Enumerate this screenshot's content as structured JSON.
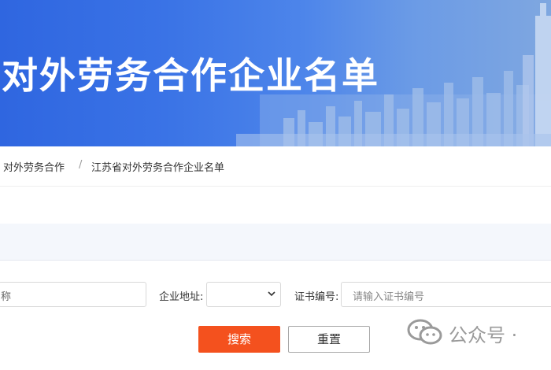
{
  "banner": {
    "title": "对外劳务合作企业名单"
  },
  "breadcrumb": {
    "items": [
      "对外劳务合作",
      "江苏省对外劳务合作企业名单"
    ],
    "separator": "/"
  },
  "search_form": {
    "name_field": {
      "value_fragment": "称"
    },
    "address_label": "企业地址:",
    "address_select": {
      "selected": ""
    },
    "cert_label": "证书编号:",
    "cert_placeholder": "请输入证书编号",
    "search_button": "搜索",
    "reset_button": "重置"
  },
  "watermark": {
    "text": "公众号 ·"
  },
  "colors": {
    "banner_blue": "#3a73e6",
    "search_button": "#f4511e",
    "band_bg": "#f4f7fc"
  },
  "icons": {
    "chevron": "chevron-down-icon",
    "watermark": "wechat-icon"
  }
}
